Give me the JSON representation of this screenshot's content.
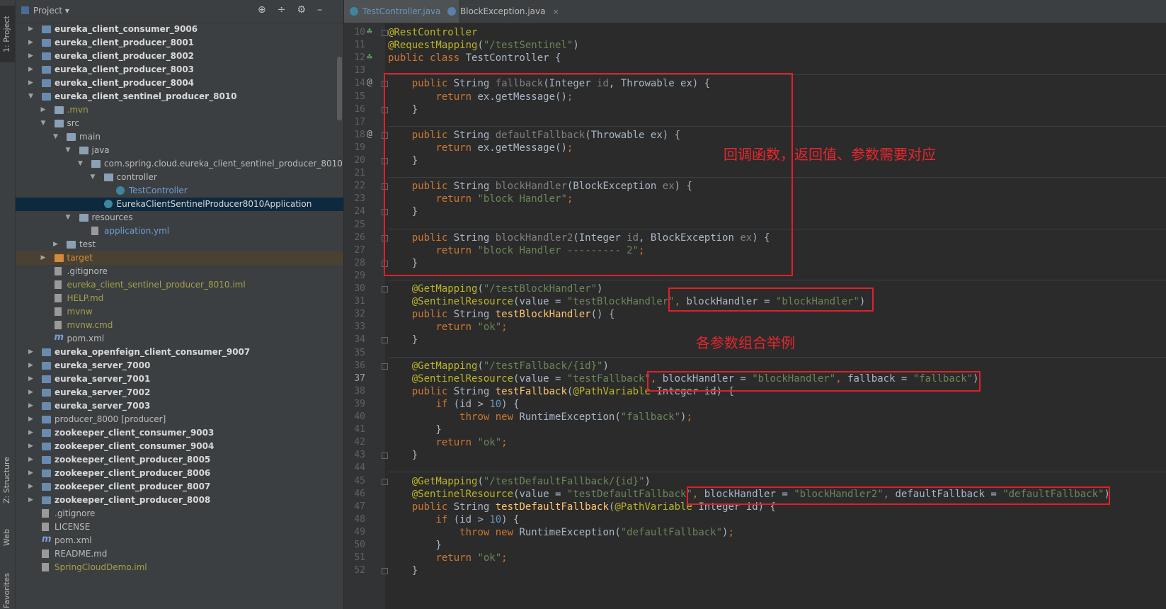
{
  "sidebar_tabs": [
    "1: Project",
    "Z: Structure",
    "Web",
    "Favorites"
  ],
  "project_panel": {
    "title": "Project",
    "header_icons": [
      "crosshair-icon",
      "collapse-icon",
      "gear-icon",
      "hide-icon"
    ]
  },
  "tree": [
    {
      "label": "eureka_client_consumer_9006",
      "depth": 0,
      "arrow": "▶",
      "icon": "module",
      "style": "bold"
    },
    {
      "label": "eureka_client_producer_8001",
      "depth": 0,
      "arrow": "▶",
      "icon": "module",
      "style": "bold"
    },
    {
      "label": "eureka_client_producer_8002",
      "depth": 0,
      "arrow": "▶",
      "icon": "module",
      "style": "bold"
    },
    {
      "label": "eureka_client_producer_8003",
      "depth": 0,
      "arrow": "▶",
      "icon": "module",
      "style": "bold"
    },
    {
      "label": "eureka_client_producer_8004",
      "depth": 0,
      "arrow": "▶",
      "icon": "module",
      "style": "bold"
    },
    {
      "label": "eureka_client_sentinel_producer_8010",
      "depth": 0,
      "arrow": "▼",
      "icon": "module",
      "style": "bold"
    },
    {
      "label": ".mvn",
      "depth": 1,
      "arrow": "▶",
      "icon": "folder",
      "style": "yellow"
    },
    {
      "label": "src",
      "depth": 1,
      "arrow": "▼",
      "icon": "folder",
      "style": "normal"
    },
    {
      "label": "main",
      "depth": 2,
      "arrow": "▼",
      "icon": "folder",
      "style": "normal"
    },
    {
      "label": "java",
      "depth": 3,
      "arrow": "▼",
      "icon": "folder",
      "style": "normal"
    },
    {
      "label": "com.spring.cloud.eureka_client_sentinel_producer_8010",
      "depth": 4,
      "arrow": "▼",
      "icon": "folder",
      "style": "normal"
    },
    {
      "label": "controller",
      "depth": 5,
      "arrow": "▼",
      "icon": "folder",
      "style": "normal"
    },
    {
      "label": "TestController",
      "depth": 6,
      "arrow": "",
      "icon": "class",
      "style": "blue"
    },
    {
      "label": "EurekaClientSentinelProducer8010Application",
      "depth": 5,
      "arrow": "",
      "icon": "class",
      "style": "white",
      "selected": true
    },
    {
      "label": "resources",
      "depth": 3,
      "arrow": "▼",
      "icon": "folder",
      "style": "normal"
    },
    {
      "label": "application.yml",
      "depth": 4,
      "arrow": "",
      "icon": "file",
      "style": "blue"
    },
    {
      "label": "test",
      "depth": 2,
      "arrow": "▶",
      "icon": "folder",
      "style": "normal"
    },
    {
      "label": "target",
      "depth": 1,
      "arrow": "▶",
      "icon": "folder-orange",
      "style": "orange",
      "target": true
    },
    {
      "label": ".gitignore",
      "depth": 1,
      "arrow": "",
      "icon": "file",
      "style": "normal"
    },
    {
      "label": "eureka_client_sentinel_producer_8010.iml",
      "depth": 1,
      "arrow": "",
      "icon": "file",
      "style": "yellow"
    },
    {
      "label": "HELP.md",
      "depth": 1,
      "arrow": "",
      "icon": "file",
      "style": "yellow"
    },
    {
      "label": "mvnw",
      "depth": 1,
      "arrow": "",
      "icon": "file",
      "style": "yellow"
    },
    {
      "label": "mvnw.cmd",
      "depth": 1,
      "arrow": "",
      "icon": "file",
      "style": "yellow"
    },
    {
      "label": "pom.xml",
      "depth": 1,
      "arrow": "",
      "icon": "maven",
      "style": "normal"
    },
    {
      "label": "eureka_openfeign_client_consumer_9007",
      "depth": 0,
      "arrow": "▶",
      "icon": "module",
      "style": "bold"
    },
    {
      "label": "eureka_server_7000",
      "depth": 0,
      "arrow": "▶",
      "icon": "module",
      "style": "bold"
    },
    {
      "label": "eureka_server_7001",
      "depth": 0,
      "arrow": "▶",
      "icon": "module",
      "style": "bold"
    },
    {
      "label": "eureka_server_7002",
      "depth": 0,
      "arrow": "▶",
      "icon": "module",
      "style": "bold"
    },
    {
      "label": "eureka_server_7003",
      "depth": 0,
      "arrow": "▶",
      "icon": "module",
      "style": "bold"
    },
    {
      "label": "producer_8000 [producer]",
      "depth": 0,
      "arrow": "▶",
      "icon": "module",
      "style": "normal"
    },
    {
      "label": "zookeeper_client_consumer_9003",
      "depth": 0,
      "arrow": "▶",
      "icon": "module",
      "style": "bold"
    },
    {
      "label": "zookeeper_client_consumer_9004",
      "depth": 0,
      "arrow": "▶",
      "icon": "module",
      "style": "bold"
    },
    {
      "label": "zookeeper_client_producer_8005",
      "depth": 0,
      "arrow": "▶",
      "icon": "module",
      "style": "bold"
    },
    {
      "label": "zookeeper_client_producer_8006",
      "depth": 0,
      "arrow": "▶",
      "icon": "module",
      "style": "bold"
    },
    {
      "label": "zookeeper_client_producer_8007",
      "depth": 0,
      "arrow": "▶",
      "icon": "module",
      "style": "bold"
    },
    {
      "label": "zookeeper_client_producer_8008",
      "depth": 0,
      "arrow": "▶",
      "icon": "module",
      "style": "bold"
    },
    {
      "label": ".gitignore",
      "depth": 0,
      "arrow": "",
      "icon": "file",
      "style": "normal"
    },
    {
      "label": "LICENSE",
      "depth": 0,
      "arrow": "",
      "icon": "file",
      "style": "normal"
    },
    {
      "label": "pom.xml",
      "depth": 0,
      "arrow": "",
      "icon": "maven",
      "style": "normal"
    },
    {
      "label": "README.md",
      "depth": 0,
      "arrow": "",
      "icon": "file",
      "style": "normal"
    },
    {
      "label": "SpringCloudDemo.iml",
      "depth": 0,
      "arrow": "",
      "icon": "file",
      "style": "yellow"
    }
  ],
  "editor_tabs": [
    {
      "label": "TestController.java",
      "active": true
    },
    {
      "label": "BlockException.java",
      "active": false
    }
  ],
  "editor": {
    "first_line": 10,
    "current_line": 37,
    "lines": [
      [
        [
          "a",
          "@RestController"
        ]
      ],
      [
        [
          "a",
          "@RequestMapping"
        ],
        [
          "p",
          "("
        ],
        [
          "s",
          "\"/testSentinel\""
        ],
        [
          "p",
          ")"
        ]
      ],
      [
        [
          "k",
          "public class "
        ],
        [
          "p",
          "TestController {"
        ]
      ],
      [],
      [
        [
          "p",
          "    "
        ],
        [
          "k",
          "public "
        ],
        [
          "p",
          "String "
        ],
        [
          "g",
          "fallback"
        ],
        [
          "p",
          "(Integer "
        ],
        [
          "g",
          "id"
        ],
        [
          "p",
          ", Throwable ex) {"
        ]
      ],
      [
        [
          "p",
          "        "
        ],
        [
          "k",
          "return "
        ],
        [
          "p",
          "ex.getMessage()"
        ],
        [
          "k",
          ";"
        ]
      ],
      [
        [
          "p",
          "    }"
        ]
      ],
      [],
      [
        [
          "p",
          "    "
        ],
        [
          "k",
          "public "
        ],
        [
          "p",
          "String "
        ],
        [
          "g",
          "defaultFallback"
        ],
        [
          "p",
          "(Throwable ex) {"
        ]
      ],
      [
        [
          "p",
          "        "
        ],
        [
          "k",
          "return "
        ],
        [
          "p",
          "ex.getMessage()"
        ],
        [
          "k",
          ";"
        ]
      ],
      [
        [
          "p",
          "    }"
        ]
      ],
      [],
      [
        [
          "p",
          "    "
        ],
        [
          "k",
          "public "
        ],
        [
          "p",
          "String "
        ],
        [
          "g",
          "blockHandler"
        ],
        [
          "p",
          "(BlockException "
        ],
        [
          "g",
          "ex"
        ],
        [
          "p",
          ") {"
        ]
      ],
      [
        [
          "p",
          "        "
        ],
        [
          "k",
          "return "
        ],
        [
          "s",
          "\"block Handler\""
        ],
        [
          "k",
          ";"
        ]
      ],
      [
        [
          "p",
          "    }"
        ]
      ],
      [],
      [
        [
          "p",
          "    "
        ],
        [
          "k",
          "public "
        ],
        [
          "p",
          "String "
        ],
        [
          "g",
          "blockHandler2"
        ],
        [
          "p",
          "(Integer "
        ],
        [
          "g",
          "id"
        ],
        [
          "p",
          ", BlockException "
        ],
        [
          "g",
          "ex"
        ],
        [
          "p",
          ") {"
        ]
      ],
      [
        [
          "p",
          "        "
        ],
        [
          "k",
          "return "
        ],
        [
          "s",
          "\"block Handler --------- 2\""
        ],
        [
          "k",
          ";"
        ]
      ],
      [
        [
          "p",
          "    }"
        ]
      ],
      [],
      [
        [
          "p",
          "    "
        ],
        [
          "a",
          "@GetMapping"
        ],
        [
          "p",
          "("
        ],
        [
          "s",
          "\"/testBlockHandler\""
        ],
        [
          "p",
          ")"
        ]
      ],
      [
        [
          "p",
          "    "
        ],
        [
          "a",
          "@SentinelResource"
        ],
        [
          "p",
          "(value = "
        ],
        [
          "s",
          "\"testBlockHandler\""
        ],
        [
          "k",
          ", "
        ],
        [
          "p",
          "blockHandler = "
        ],
        [
          "s",
          "\"blockHandler\""
        ],
        [
          "p",
          ")"
        ]
      ],
      [
        [
          "p",
          "    "
        ],
        [
          "k",
          "public "
        ],
        [
          "p",
          "String "
        ],
        [
          "f",
          "testBlockHandler"
        ],
        [
          "p",
          "() {"
        ]
      ],
      [
        [
          "p",
          "        "
        ],
        [
          "k",
          "return "
        ],
        [
          "s",
          "\"ok\""
        ],
        [
          "k",
          ";"
        ]
      ],
      [
        [
          "p",
          "    }"
        ]
      ],
      [],
      [
        [
          "p",
          "    "
        ],
        [
          "a",
          "@GetMapping"
        ],
        [
          "p",
          "("
        ],
        [
          "s",
          "\"/testFallback/{id}\""
        ],
        [
          "p",
          ")"
        ]
      ],
      [
        [
          "p",
          "    "
        ],
        [
          "a",
          "@SentinelResource"
        ],
        [
          "p",
          "(value = "
        ],
        [
          "s",
          "\"testFallback\""
        ],
        [
          "k",
          ", "
        ],
        [
          "p",
          "blockHandler = "
        ],
        [
          "s",
          "\"blockHandler\""
        ],
        [
          "k",
          ", "
        ],
        [
          "p",
          "fallback = "
        ],
        [
          "s",
          "\"fallback\""
        ],
        [
          "p",
          ")"
        ]
      ],
      [
        [
          "p",
          "    "
        ],
        [
          "k",
          "public "
        ],
        [
          "p",
          "String "
        ],
        [
          "f",
          "testFallback"
        ],
        [
          "p",
          "("
        ],
        [
          "a",
          "@PathVariable "
        ],
        [
          "p",
          "Integer id) {"
        ]
      ],
      [
        [
          "p",
          "        "
        ],
        [
          "k",
          "if "
        ],
        [
          "p",
          "(id > "
        ],
        [
          "n",
          "10"
        ],
        [
          "p",
          ") {"
        ]
      ],
      [
        [
          "p",
          "            "
        ],
        [
          "k",
          "throw new "
        ],
        [
          "p",
          "RuntimeException("
        ],
        [
          "s",
          "\"fallback\""
        ],
        [
          "p",
          ")"
        ],
        [
          "k",
          ";"
        ]
      ],
      [
        [
          "p",
          "        }"
        ]
      ],
      [
        [
          "p",
          "        "
        ],
        [
          "k",
          "return "
        ],
        [
          "s",
          "\"ok\""
        ],
        [
          "k",
          ";"
        ]
      ],
      [
        [
          "p",
          "    }"
        ]
      ],
      [],
      [
        [
          "p",
          "    "
        ],
        [
          "a",
          "@GetMapping"
        ],
        [
          "p",
          "("
        ],
        [
          "s",
          "\"/testDefaultFallback/{id}\""
        ],
        [
          "p",
          ")"
        ]
      ],
      [
        [
          "p",
          "    "
        ],
        [
          "a",
          "@SentinelResource"
        ],
        [
          "p",
          "(value = "
        ],
        [
          "s",
          "\"testDefaultFallback\""
        ],
        [
          "k",
          ", "
        ],
        [
          "p",
          "blockHandler = "
        ],
        [
          "s",
          "\"blockHandler2\""
        ],
        [
          "k",
          ", "
        ],
        [
          "p",
          "defaultFallback = "
        ],
        [
          "s",
          "\"defaultFallback\""
        ],
        [
          "p",
          ")"
        ]
      ],
      [
        [
          "p",
          "    "
        ],
        [
          "k",
          "public "
        ],
        [
          "p",
          "String "
        ],
        [
          "f",
          "testDefaultFallback"
        ],
        [
          "p",
          "("
        ],
        [
          "a",
          "@PathVariable "
        ],
        [
          "p",
          "Integer id) {"
        ]
      ],
      [
        [
          "p",
          "        "
        ],
        [
          "k",
          "if "
        ],
        [
          "p",
          "(id > "
        ],
        [
          "n",
          "10"
        ],
        [
          "p",
          ") {"
        ]
      ],
      [
        [
          "p",
          "            "
        ],
        [
          "k",
          "throw new "
        ],
        [
          "p",
          "RuntimeException("
        ],
        [
          "s",
          "\"defaultFallback\""
        ],
        [
          "p",
          ")"
        ],
        [
          "k",
          ";"
        ]
      ],
      [
        [
          "p",
          "        }"
        ]
      ],
      [
        [
          "p",
          "        "
        ],
        [
          "k",
          "return "
        ],
        [
          "s",
          "\"ok\""
        ],
        [
          "k",
          ";"
        ]
      ],
      [
        [
          "p",
          "    }"
        ]
      ]
    ]
  },
  "annotations": {
    "callback_note": "回调函数，返回值、参数需要对应",
    "combo_note": "各参数组合举例"
  },
  "colors": {
    "box": "#e0202a",
    "note": "#e8262e"
  }
}
